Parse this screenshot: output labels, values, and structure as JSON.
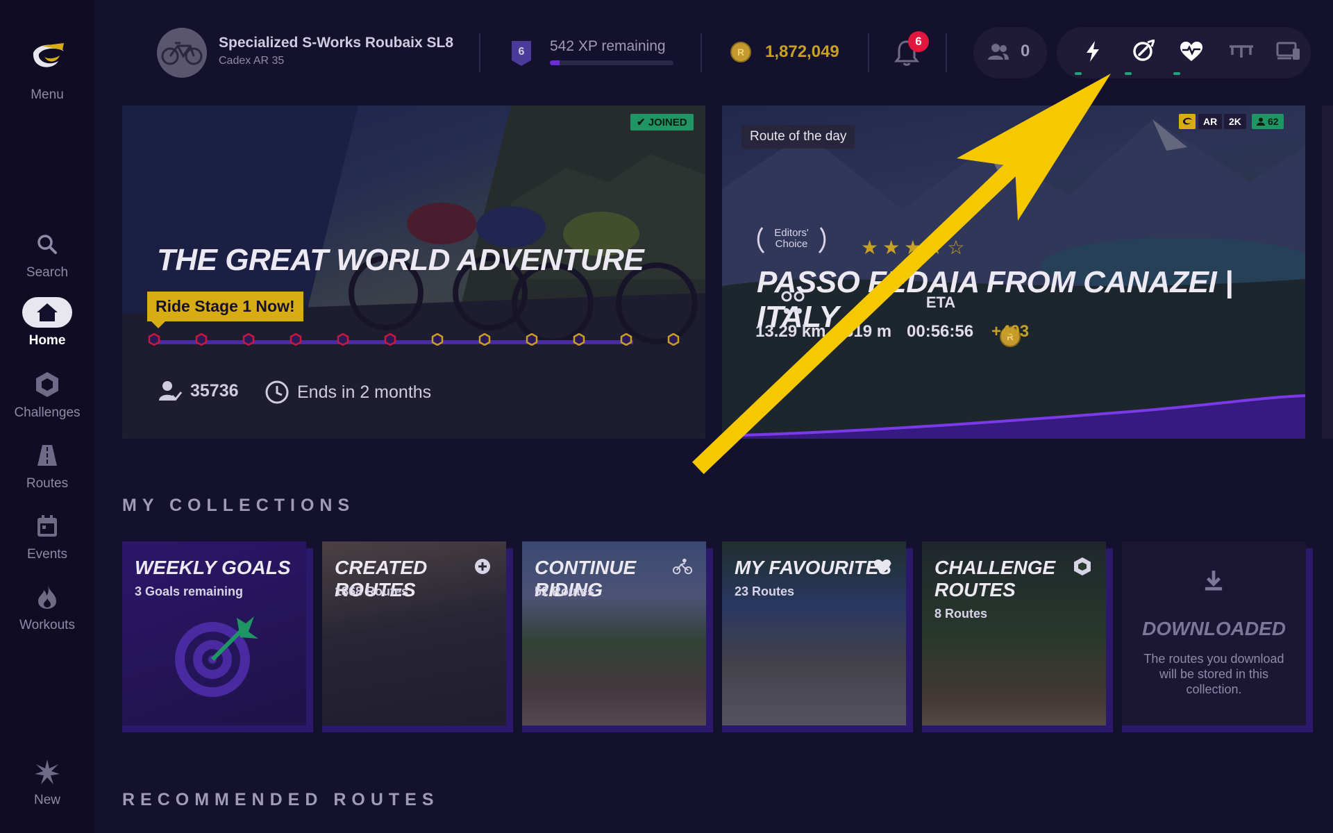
{
  "sidebar": {
    "menu_label": "Menu",
    "items": [
      {
        "label": "Search",
        "icon": "search-icon"
      },
      {
        "label": "Home",
        "icon": "home-icon",
        "active": true
      },
      {
        "label": "Challenges",
        "icon": "hexagon-icon"
      },
      {
        "label": "Routes",
        "icon": "road-icon"
      },
      {
        "label": "Events",
        "icon": "calendar-icon"
      },
      {
        "label": "Workouts",
        "icon": "flame-icon"
      },
      {
        "label": "New",
        "icon": "sparkle-icon"
      }
    ]
  },
  "topbar": {
    "bike_name": "Specialized S-Works Roubaix SL8",
    "wheels": "Cadex AR 35",
    "level": "6",
    "xp_remaining": "542 XP remaining",
    "xp_progress": 0.08,
    "coin_symbol": "R",
    "coins": "1,872,049",
    "notifications": "6",
    "friends_online": "0"
  },
  "hero_challenge": {
    "badge": "✔ JOINED",
    "title": "THE GREAT WORLD ADVENTURE",
    "cta": "Ride Stage 1 Now!",
    "stages_total": 12,
    "participants": "35736",
    "ends": "Ends in 2 months"
  },
  "hero_route": {
    "label": "Route of the day",
    "tags": [
      "AR",
      "2K",
      "62"
    ],
    "editors_choice": [
      "Editors'",
      "Choice"
    ],
    "rating": "★★★★☆",
    "title": "PASSO FEDAIA FROM CANAZEI | ITALY",
    "distance": "13.29 km",
    "elevation": "619 m",
    "eta_label": "ETA",
    "eta": "00:56:56",
    "reward": "+403"
  },
  "collections": {
    "title": "MY COLLECTIONS",
    "items": [
      {
        "title": "WEEKLY GOALS",
        "sub": "3 Goals remaining"
      },
      {
        "title": "CREATED ROUTES",
        "sub": "1868 Routes"
      },
      {
        "title": "CONTINUE RIDING",
        "sub": "52 Routes"
      },
      {
        "title": "MY FAVOURITES",
        "sub": "23 Routes"
      },
      {
        "title": "CHALLENGE ROUTES",
        "sub": "8 Routes"
      },
      {
        "title": "DOWNLOADED",
        "sub": "The routes you download will be stored in this collection."
      }
    ]
  },
  "recommended": {
    "title": "RECOMMENDED ROUTES"
  },
  "colors": {
    "accent": "#6a2fd0",
    "gold": "#c8a024",
    "joined": "#1f9566",
    "arrow": "#f5c800"
  }
}
